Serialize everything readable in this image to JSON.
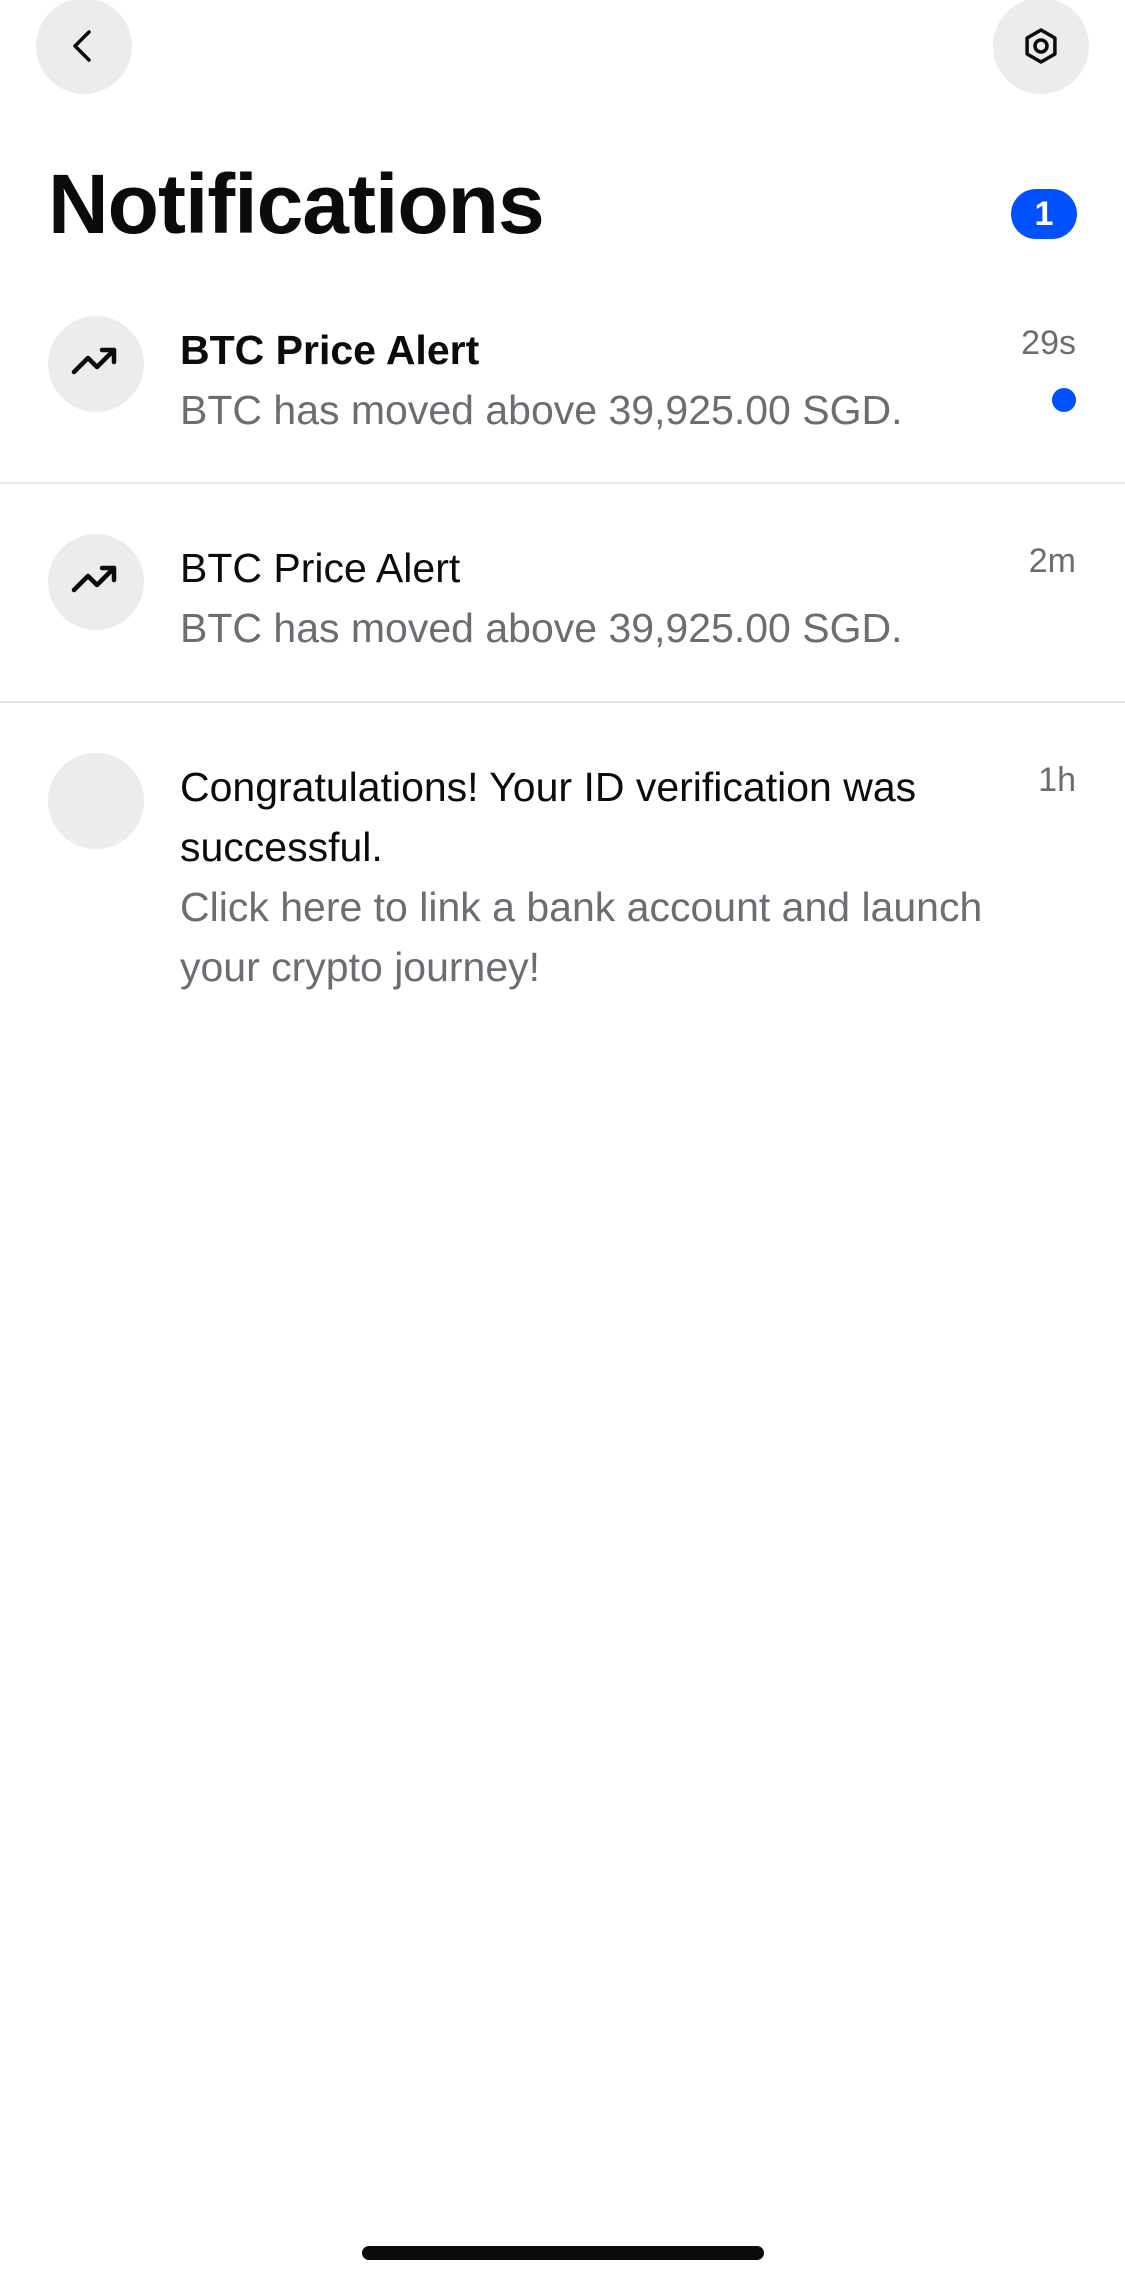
{
  "header": {
    "back_icon": "chevron-left-icon",
    "settings_icon": "gear-icon",
    "title": "Notifications",
    "unread_count": "1"
  },
  "notifications": [
    {
      "icon": "trending-up-icon",
      "title": "BTC Price Alert",
      "message": "BTC has moved above 39,925.00 SGD.",
      "time": "29s",
      "unread": true
    },
    {
      "icon": "trending-up-icon",
      "title": "BTC Price Alert",
      "message": "BTC has moved above 39,925.00 SGD.",
      "time": "2m",
      "unread": false
    },
    {
      "icon": "blank-avatar",
      "title": "Congratulations! Your ID verification was successful.",
      "message": "Click here to link a bank account and launch your crypto journey!",
      "time": "1h",
      "unread": false
    }
  ],
  "colors": {
    "accent": "#0052ff",
    "icon_bg": "#ececec",
    "secondary_text": "#6b6d72"
  }
}
